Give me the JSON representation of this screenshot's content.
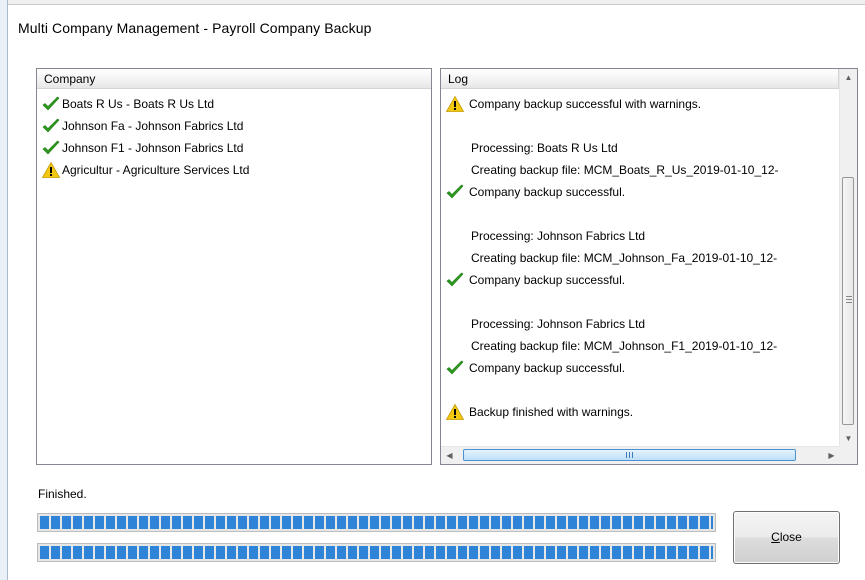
{
  "window": {
    "title": "Multi Company Management - Payroll Company Backup"
  },
  "company_list": {
    "header": "Company",
    "items": [
      {
        "label": "Boats R Us - Boats R Us Ltd",
        "icon": "check-icon"
      },
      {
        "label": "Johnson Fa - Johnson Fabrics Ltd",
        "icon": "check-icon"
      },
      {
        "label": "Johnson F1 - Johnson Fabrics Ltd",
        "icon": "check-icon"
      },
      {
        "label": "Agricultur - Agriculture Services Ltd",
        "icon": "warning-icon"
      }
    ]
  },
  "log": {
    "header": "Log",
    "lines": [
      {
        "text": "Company backup successful with warnings.",
        "icon": "warning-icon"
      },
      {
        "text": "Processing: Boats R Us Ltd"
      },
      {
        "text": "Creating backup file: MCM_Boats_R_Us_2019-01-10_12-"
      },
      {
        "text": "Company backup successful.",
        "icon": "check-icon"
      },
      {
        "text": "Processing: Johnson Fabrics Ltd"
      },
      {
        "text": "Creating backup file: MCM_Johnson_Fa_2019-01-10_12-"
      },
      {
        "text": "Company backup successful.",
        "icon": "check-icon"
      },
      {
        "text": "Processing: Johnson Fabrics Ltd"
      },
      {
        "text": "Creating backup file: MCM_Johnson_F1_2019-01-10_12-"
      },
      {
        "text": "Company backup successful.",
        "icon": "check-icon"
      },
      {
        "text": "Backup finished with warnings.",
        "icon": "warning-icon"
      }
    ]
  },
  "status_text": "Finished.",
  "progress": {
    "overall": 1.0,
    "current": 1.0
  },
  "buttons": {
    "close_label": "Close",
    "close_mnemonic": "C"
  },
  "colors": {
    "check": "#2e9b1f",
    "warning": "#f2c811",
    "progress": "#2f84d8"
  }
}
